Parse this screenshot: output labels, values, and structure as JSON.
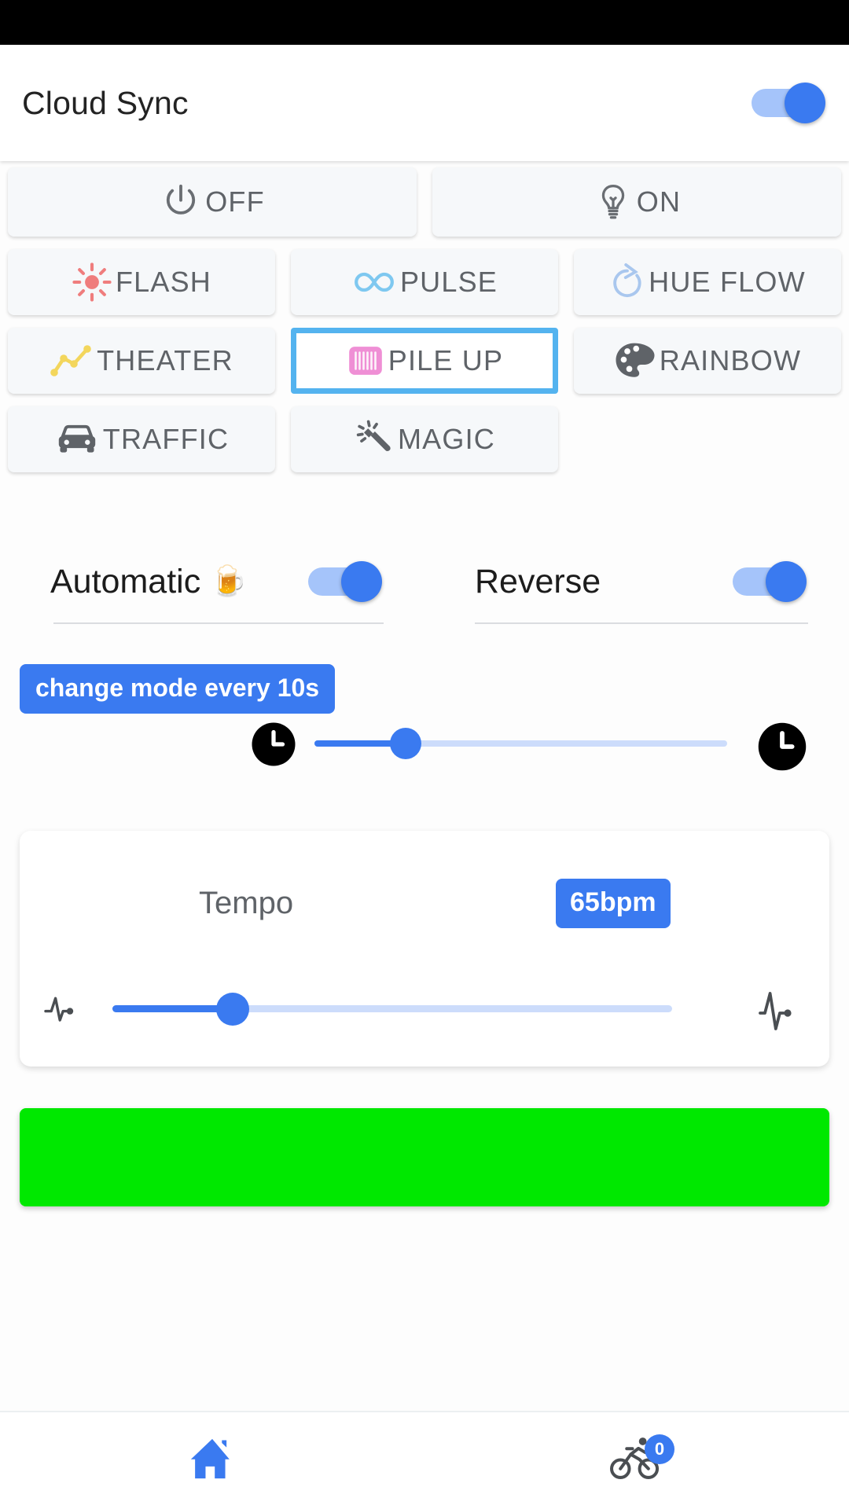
{
  "app": {
    "title": "Cloud Sync",
    "sync_toggle_state": "on"
  },
  "colors": {
    "accent_blue": "#3a7af0",
    "track_blue": "#ccdcfb",
    "selected_border": "#54b3ef",
    "button_bg": "#f6f8fa",
    "label_gray": "#5f6368",
    "color_bar": "#00e800",
    "flash_red": "#ef7d7d",
    "pulse_blue": "#7ec8f0",
    "hue_flow_blue": "#a9c7ee",
    "theater_yellow": "#f3d65c",
    "pile_up_pink": "#ef8fd5",
    "rainbow_gray": "#5f6368"
  },
  "modes": {
    "row_onoff": [
      {
        "label": "OFF",
        "icon": "power-icon",
        "selected": false
      },
      {
        "label": "ON",
        "icon": "lightbulb-icon",
        "selected": false
      }
    ],
    "row_effects_1": [
      {
        "label": "FLASH",
        "icon": "sun-flash-icon",
        "selected": false
      },
      {
        "label": "PULSE",
        "icon": "infinity-icon",
        "selected": false
      },
      {
        "label": "HUE FLOW",
        "icon": "refresh-rotate-icon",
        "selected": false
      }
    ],
    "row_effects_2": [
      {
        "label": "THEATER",
        "icon": "line-chart-icon",
        "selected": false
      },
      {
        "label": "PILE UP",
        "icon": "barcode-icon",
        "selected": true
      },
      {
        "label": "RAINBOW",
        "icon": "palette-icon",
        "selected": false
      }
    ],
    "row_effects_3": [
      {
        "label": "TRAFFIC",
        "icon": "car-icon",
        "selected": false
      },
      {
        "label": "MAGIC",
        "icon": "magic-wand-icon",
        "selected": false
      }
    ]
  },
  "options": {
    "automatic": {
      "label": "Automatic",
      "emoji": "🍺",
      "state": "on"
    },
    "reverse": {
      "label": "Reverse",
      "state": "on"
    }
  },
  "interval": {
    "bubble_text": "change mode every 10s",
    "left_icon": "clock-icon",
    "right_icon": "clock-icon",
    "fill_percent": 22
  },
  "tempo": {
    "label": "Tempo",
    "value": "65bpm",
    "left_icon": "heartbeat-slow-icon",
    "right_icon": "heartbeat-fast-icon",
    "fill_percent": 21.5
  },
  "bottom_nav": {
    "items": [
      {
        "icon": "home-icon",
        "active": true,
        "badge": null
      },
      {
        "icon": "bicycle-icon",
        "active": false,
        "badge": "0"
      }
    ]
  }
}
